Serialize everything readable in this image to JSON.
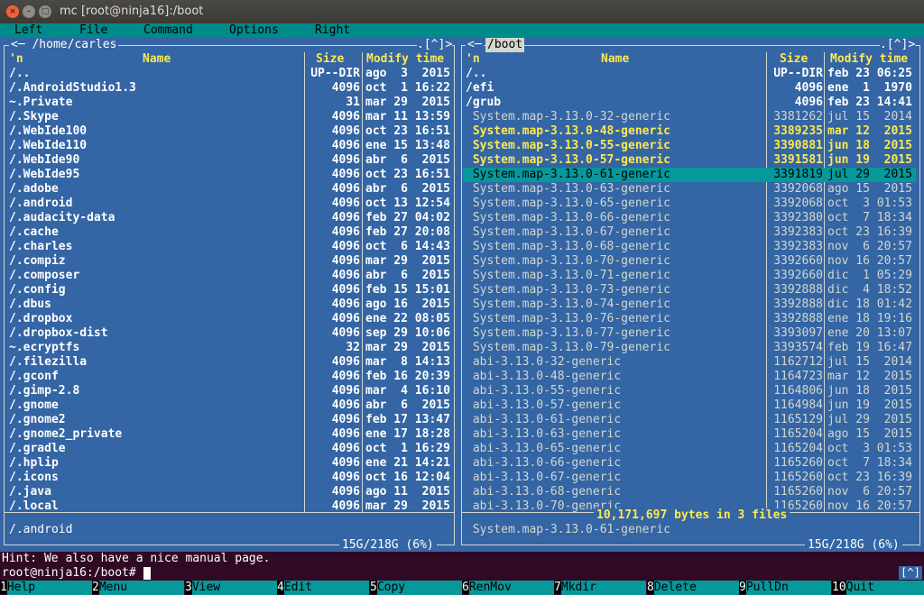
{
  "window": {
    "title": "mc [root@ninja16]:/boot"
  },
  "menu": [
    "Left",
    "File",
    "Command",
    "Options",
    "Right"
  ],
  "left_panel": {
    "path": "/home/carles",
    "corner": "[^]",
    "col_n": "'n",
    "col_name": "Name",
    "col_size": "Size",
    "col_modify": "Modify time",
    "rows": [
      {
        "name": "/..",
        "size": "UP--DIR",
        "date": "ago  3  2015",
        "style": "dir"
      },
      {
        "name": "/.AndroidStudio1.3",
        "size": "4096",
        "date": "oct  1 16:22",
        "style": "dir"
      },
      {
        "name": "~.Private",
        "size": "31",
        "date": "mar 29  2015",
        "style": "dir"
      },
      {
        "name": "/.Skype",
        "size": "4096",
        "date": "mar 11 13:59",
        "style": "dir"
      },
      {
        "name": "/.WebIde100",
        "size": "4096",
        "date": "oct 23 16:51",
        "style": "dir"
      },
      {
        "name": "/.WebIde110",
        "size": "4096",
        "date": "ene 15 13:48",
        "style": "dir"
      },
      {
        "name": "/.WebIde90",
        "size": "4096",
        "date": "abr  6  2015",
        "style": "dir"
      },
      {
        "name": "/.WebIde95",
        "size": "4096",
        "date": "oct 23 16:51",
        "style": "dir"
      },
      {
        "name": "/.adobe",
        "size": "4096",
        "date": "abr  6  2015",
        "style": "dir"
      },
      {
        "name": "/.android",
        "size": "4096",
        "date": "oct 13 12:54",
        "style": "dir"
      },
      {
        "name": "/.audacity-data",
        "size": "4096",
        "date": "feb 27 04:02",
        "style": "dir"
      },
      {
        "name": "/.cache",
        "size": "4096",
        "date": "feb 27 20:08",
        "style": "dir"
      },
      {
        "name": "/.charles",
        "size": "4096",
        "date": "oct  6 14:43",
        "style": "dir"
      },
      {
        "name": "/.compiz",
        "size": "4096",
        "date": "mar 29  2015",
        "style": "dir"
      },
      {
        "name": "/.composer",
        "size": "4096",
        "date": "abr  6  2015",
        "style": "dir"
      },
      {
        "name": "/.config",
        "size": "4096",
        "date": "feb 15 15:01",
        "style": "dir"
      },
      {
        "name": "/.dbus",
        "size": "4096",
        "date": "ago 16  2015",
        "style": "dir"
      },
      {
        "name": "/.dropbox",
        "size": "4096",
        "date": "ene 22 08:05",
        "style": "dir"
      },
      {
        "name": "/.dropbox-dist",
        "size": "4096",
        "date": "sep 29 10:06",
        "style": "dir"
      },
      {
        "name": "~.ecryptfs",
        "size": "32",
        "date": "mar 29  2015",
        "style": "dir"
      },
      {
        "name": "/.filezilla",
        "size": "4096",
        "date": "mar  8 14:13",
        "style": "dir"
      },
      {
        "name": "/.gconf",
        "size": "4096",
        "date": "feb 16 20:39",
        "style": "dir"
      },
      {
        "name": "/.gimp-2.8",
        "size": "4096",
        "date": "mar  4 16:10",
        "style": "dir"
      },
      {
        "name": "/.gnome",
        "size": "4096",
        "date": "abr  6  2015",
        "style": "dir"
      },
      {
        "name": "/.gnome2",
        "size": "4096",
        "date": "feb 17 13:47",
        "style": "dir"
      },
      {
        "name": "/.gnome2_private",
        "size": "4096",
        "date": "ene 17 18:28",
        "style": "dir"
      },
      {
        "name": "/.gradle",
        "size": "4096",
        "date": "oct  1 16:29",
        "style": "dir"
      },
      {
        "name": "/.hplip",
        "size": "4096",
        "date": "ene 21 14:21",
        "style": "dir"
      },
      {
        "name": "/.icons",
        "size": "4096",
        "date": "oct 16 12:04",
        "style": "dir"
      },
      {
        "name": "/.java",
        "size": "4096",
        "date": "ago 11  2015",
        "style": "dir"
      },
      {
        "name": "/.local",
        "size": "4096",
        "date": "mar 29  2015",
        "style": "dir"
      }
    ],
    "mini_status": "/.android",
    "disk": "15G/218G (6%)"
  },
  "right_panel": {
    "path": "/boot",
    "corner": "[^]",
    "col_n": "'n",
    "col_name": "Name",
    "col_size": "Size",
    "col_modify": "Modify time",
    "rows": [
      {
        "name": "/..",
        "size": "UP--DIR",
        "date": "feb 23 06:25",
        "style": "dir"
      },
      {
        "name": "/efi",
        "size": "4096",
        "date": "ene  1  1970",
        "style": "dir"
      },
      {
        "name": "/grub",
        "size": "4096",
        "date": "feb 23 14:41",
        "style": "dir"
      },
      {
        "name": " System.map-3.13.0-32-generic",
        "size": "3381262",
        "date": "jul 15  2014",
        "style": "plain"
      },
      {
        "name": " System.map-3.13.0-48-generic",
        "size": "3389235",
        "date": "mar 12  2015",
        "style": "marked"
      },
      {
        "name": " System.map-3.13.0-55-generic",
        "size": "3390881",
        "date": "jun 18  2015",
        "style": "marked"
      },
      {
        "name": " System.map-3.13.0-57-generic",
        "size": "3391581",
        "date": "jun 19  2015",
        "style": "marked"
      },
      {
        "name": " System.map-3.13.0-61-generic",
        "size": "3391819",
        "date": "jul 29  2015",
        "style": "cursor"
      },
      {
        "name": " System.map-3.13.0-63-generic",
        "size": "3392068",
        "date": "ago 15  2015",
        "style": "plain"
      },
      {
        "name": " System.map-3.13.0-65-generic",
        "size": "3392068",
        "date": "oct  3 01:53",
        "style": "plain"
      },
      {
        "name": " System.map-3.13.0-66-generic",
        "size": "3392380",
        "date": "oct  7 18:34",
        "style": "plain"
      },
      {
        "name": " System.map-3.13.0-67-generic",
        "size": "3392383",
        "date": "oct 23 16:39",
        "style": "plain"
      },
      {
        "name": " System.map-3.13.0-68-generic",
        "size": "3392383",
        "date": "nov  6 20:57",
        "style": "plain"
      },
      {
        "name": " System.map-3.13.0-70-generic",
        "size": "3392660",
        "date": "nov 16 20:57",
        "style": "plain"
      },
      {
        "name": " System.map-3.13.0-71-generic",
        "size": "3392660",
        "date": "dic  1 05:29",
        "style": "plain"
      },
      {
        "name": " System.map-3.13.0-73-generic",
        "size": "3392888",
        "date": "dic  4 18:52",
        "style": "plain"
      },
      {
        "name": " System.map-3.13.0-74-generic",
        "size": "3392888",
        "date": "dic 18 01:42",
        "style": "plain"
      },
      {
        "name": " System.map-3.13.0-76-generic",
        "size": "3392888",
        "date": "ene 18 19:16",
        "style": "plain"
      },
      {
        "name": " System.map-3.13.0-77-generic",
        "size": "3393097",
        "date": "ene 20 13:07",
        "style": "plain"
      },
      {
        "name": " System.map-3.13.0-79-generic",
        "size": "3393574",
        "date": "feb 19 16:47",
        "style": "plain"
      },
      {
        "name": " abi-3.13.0-32-generic",
        "size": "1162712",
        "date": "jul 15  2014",
        "style": "plain"
      },
      {
        "name": " abi-3.13.0-48-generic",
        "size": "1164723",
        "date": "mar 12  2015",
        "style": "plain"
      },
      {
        "name": " abi-3.13.0-55-generic",
        "size": "1164806",
        "date": "jun 18  2015",
        "style": "plain"
      },
      {
        "name": " abi-3.13.0-57-generic",
        "size": "1164984",
        "date": "jun 19  2015",
        "style": "plain"
      },
      {
        "name": " abi-3.13.0-61-generic",
        "size": "1165129",
        "date": "jul 29  2015",
        "style": "plain"
      },
      {
        "name": " abi-3.13.0-63-generic",
        "size": "1165204",
        "date": "ago 15  2015",
        "style": "plain"
      },
      {
        "name": " abi-3.13.0-65-generic",
        "size": "1165204",
        "date": "oct  3 01:53",
        "style": "plain"
      },
      {
        "name": " abi-3.13.0-66-generic",
        "size": "1165260",
        "date": "oct  7 18:34",
        "style": "plain"
      },
      {
        "name": " abi-3.13.0-67-generic",
        "size": "1165260",
        "date": "oct 23 16:39",
        "style": "plain"
      },
      {
        "name": " abi-3.13.0-68-generic",
        "size": "1165260",
        "date": "nov  6 20:57",
        "style": "plain"
      },
      {
        "name": " abi-3.13.0-70-generic",
        "size": "1165260",
        "date": "nov 16 20:57",
        "style": "plain"
      }
    ],
    "selection_summary": "10,171,697 bytes in 3 files",
    "mini_status": " System.map-3.13.0-61-generic",
    "disk": "15G/218G (6%)"
  },
  "hint": "Hint: We also have a nice manual page.",
  "prompt": "root@ninja16:/boot# ",
  "prompt_corner": "[^]",
  "fkeys": [
    {
      "num": "1",
      "label": "Help"
    },
    {
      "num": "2",
      "label": "Menu"
    },
    {
      "num": "3",
      "label": "View"
    },
    {
      "num": "4",
      "label": "Edit"
    },
    {
      "num": "5",
      "label": "Copy"
    },
    {
      "num": "6",
      "label": "RenMov"
    },
    {
      "num": "7",
      "label": "Mkdir"
    },
    {
      "num": "8",
      "label": "Delete"
    },
    {
      "num": "9",
      "label": "PullDn"
    },
    {
      "num": "10",
      "label": "Quit"
    }
  ],
  "colors": {
    "panel_bg": "#3465a4",
    "menubar_bg": "#008b8b",
    "cursor_bg": "#06989a",
    "marked": "#fce94f",
    "terminal_bg": "#300a24"
  }
}
